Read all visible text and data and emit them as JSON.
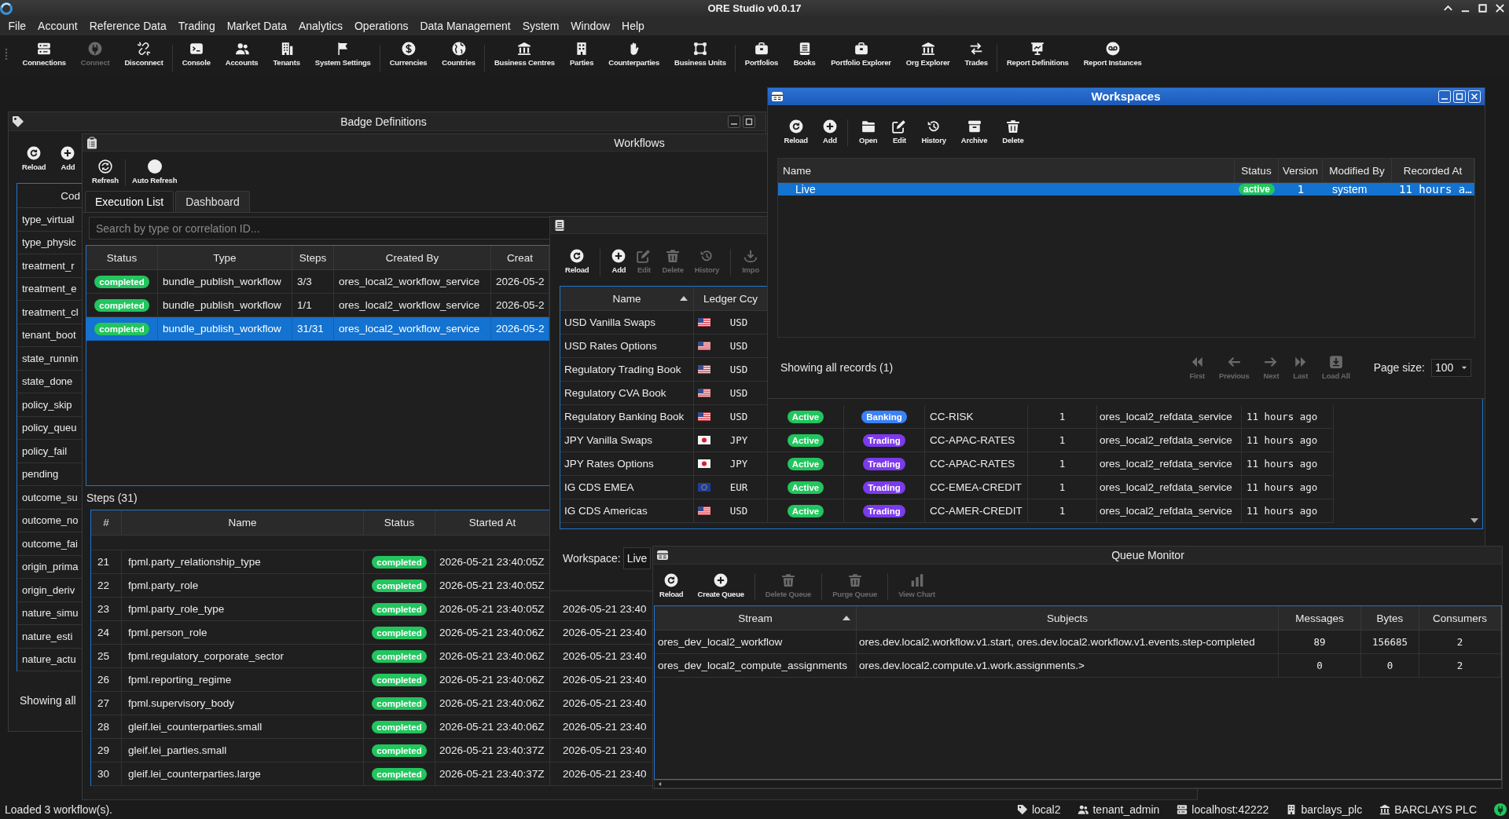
{
  "window": {
    "title": "ORE Studio v0.0.17"
  },
  "menu": [
    "File",
    "Account",
    "Reference Data",
    "Trading",
    "Market Data",
    "Analytics",
    "Operations",
    "Data Management",
    "System",
    "Window",
    "Help"
  ],
  "toolbar": [
    [
      {
        "label": "Connections",
        "disabled": false
      },
      {
        "label": "Connect",
        "disabled": true
      },
      {
        "label": "Disconnect",
        "disabled": false
      }
    ],
    [
      {
        "label": "Console",
        "disabled": false
      },
      {
        "label": "Accounts",
        "disabled": false
      },
      {
        "label": "Tenants",
        "disabled": false
      },
      {
        "label": "System Settings",
        "disabled": false
      }
    ],
    [
      {
        "label": "Currencies",
        "disabled": false
      },
      {
        "label": "Countries",
        "disabled": false
      }
    ],
    [
      {
        "label": "Business Centres",
        "disabled": false
      },
      {
        "label": "Parties",
        "disabled": false
      },
      {
        "label": "Counterparties",
        "disabled": false
      },
      {
        "label": "Business Units",
        "disabled": false
      }
    ],
    [
      {
        "label": "Portfolios",
        "disabled": false
      },
      {
        "label": "Books",
        "disabled": false
      },
      {
        "label": "Portfolio Explorer",
        "disabled": false
      },
      {
        "label": "Org Explorer",
        "disabled": false
      },
      {
        "label": "Trades",
        "disabled": false
      }
    ],
    [
      {
        "label": "Report Definitions",
        "disabled": false
      },
      {
        "label": "Report Instances",
        "disabled": false
      }
    ]
  ],
  "badge_definitions": {
    "title": "Badge Definitions",
    "active": false,
    "toolbar": [
      {
        "label": "Reload",
        "disabled": false
      },
      {
        "label": "Add",
        "disabled": false
      }
    ],
    "table": {
      "columns": [
        "Cod"
      ],
      "rows": [
        "type_virtual",
        "type_physic",
        "treatment_r",
        "treatment_e",
        "treatment_cl",
        "tenant_boot",
        "state_runnin",
        "state_done",
        "policy_skip",
        "policy_queu",
        "policy_fail",
        "pending",
        "outcome_su",
        "outcome_no",
        "outcome_fai",
        "origin_prima",
        "origin_deriv",
        "nature_simu",
        "nature_esti",
        "nature_actu"
      ]
    },
    "footer": "Showing all"
  },
  "workflows": {
    "title": "Workflows",
    "active": false,
    "toolbar": [
      {
        "label": "Refresh",
        "disabled": false
      },
      {
        "label": "Auto Refresh",
        "disabled": false
      }
    ],
    "tabs": [
      {
        "label": "Execution List",
        "selected": true
      },
      {
        "label": "Dashboard",
        "selected": false
      }
    ],
    "search": {
      "placeholder": "Search by type or correlation ID..."
    },
    "executions": {
      "columns": [
        "Status",
        "Type",
        "Steps",
        "Created By",
        "Creat"
      ],
      "rows": [
        {
          "status": "completed",
          "type": "bundle_publish_workflow",
          "steps": "3/3",
          "created_by": "ores_local2_workflow_service",
          "column_5": "2026-05-2",
          "selected": false
        },
        {
          "status": "completed",
          "type": "bundle_publish_workflow",
          "steps": "1/1",
          "created_by": "ores_local2_workflow_service",
          "column_5": "2026-05-2",
          "selected": false
        },
        {
          "status": "completed",
          "type": "bundle_publish_workflow",
          "steps": "31/31",
          "created_by": "ores_local2_workflow_service",
          "column_5": "2026-05-2",
          "selected": true
        }
      ]
    },
    "steps": {
      "title": "Steps (31)",
      "columns": [
        "#",
        "Name",
        "Status",
        "Started At"
      ],
      "rows": [
        {
          "number": "21",
          "name": "fpml.party_relationship_type",
          "status": "completed",
          "started_at": "2026-05-21 23:40:05Z"
        },
        {
          "number": "22",
          "name": "fpml.party_role",
          "status": "completed",
          "started_at": "2026-05-21 23:40:05Z"
        },
        {
          "number": "23",
          "name": "fpml.party_role_type",
          "status": "completed",
          "started_at": "2026-05-21 23:40:05Z",
          "column_5": "2026-05-21 23:40"
        },
        {
          "number": "24",
          "name": "fpml.person_role",
          "status": "completed",
          "started_at": "2026-05-21 23:40:06Z",
          "column_5": "2026-05-21 23:40"
        },
        {
          "number": "25",
          "name": "fpml.regulatory_corporate_sector",
          "status": "completed",
          "started_at": "2026-05-21 23:40:06Z",
          "column_5": "2026-05-21 23:40"
        },
        {
          "number": "26",
          "name": "fpml.reporting_regime",
          "status": "completed",
          "started_at": "2026-05-21 23:40:06Z",
          "column_5": "2026-05-21 23:40"
        },
        {
          "number": "27",
          "name": "fpml.supervisory_body",
          "status": "completed",
          "started_at": "2026-05-21 23:40:06Z",
          "column_5": "2026-05-21 23:40"
        },
        {
          "number": "28",
          "name": "gleif.lei_counterparties.small",
          "status": "completed",
          "started_at": "2026-05-21 23:40:06Z",
          "column_5": "2026-05-21 23:40"
        },
        {
          "number": "29",
          "name": "gleif.lei_parties.small",
          "status": "completed",
          "started_at": "2026-05-21 23:40:37Z",
          "column_5": "2026-05-21 23:40"
        },
        {
          "number": "30",
          "name": "gleif.lei_counterparties.large",
          "status": "completed",
          "started_at": "2026-05-21 23:40:37Z",
          "column_5": "2026-05-21 23:40"
        }
      ]
    }
  },
  "books": {
    "active": false,
    "toolbar": [
      {
        "label": "Reload",
        "disabled": false
      },
      {
        "label": "Add",
        "disabled": false
      },
      {
        "label": "Edit",
        "disabled": true
      },
      {
        "label": "Delete",
        "disabled": true
      },
      {
        "label": "History",
        "disabled": true
      },
      {
        "label": "Impo",
        "disabled": true
      }
    ],
    "table": {
      "columns": [
        {
          "label": "Name",
          "sorted": true
        },
        {
          "label": "Ledger Ccy",
          "sorted": false
        }
      ],
      "rows": [
        {
          "name": "USD Vanilla Swaps",
          "kind": "us",
          "ledger_ccy": "USD"
        },
        {
          "name": "USD Rates Options",
          "kind": "us",
          "ledger_ccy": "USD"
        },
        {
          "name": "Regulatory Trading Book",
          "kind": "us",
          "ledger_ccy": "USD"
        },
        {
          "name": "Regulatory CVA Book",
          "kind": "us",
          "ledger_ccy": "USD"
        },
        {
          "name": "Regulatory Banking Book",
          "kind": "us",
          "ledger_ccy": "USD",
          "column_3": "Active",
          "column_4": {
            "text": "Banking",
            "color": "#3b82f6"
          },
          "column_5": "CC-RISK",
          "column_6": "1",
          "column_7": "ores_local2_refdata_service",
          "column_8": "11 hours ago"
        },
        {
          "name": "JPY Vanilla Swaps",
          "kind": "jp",
          "ledger_ccy": "JPY",
          "column_3": "Active",
          "column_4": {
            "text": "Trading",
            "color": "#7c3aed"
          },
          "column_5": "CC-APAC-RATES",
          "column_6": "1",
          "column_7": "ores_local2_refdata_service",
          "column_8": "11 hours ago"
        },
        {
          "name": "JPY Rates Options",
          "kind": "jp",
          "ledger_ccy": "JPY",
          "column_3": "Active",
          "column_4": {
            "text": "Trading",
            "color": "#7c3aed"
          },
          "column_5": "CC-APAC-RATES",
          "column_6": "1",
          "column_7": "ores_local2_refdata_service",
          "column_8": "11 hours ago"
        },
        {
          "name": "IG CDS EMEA",
          "kind": "eu",
          "ledger_ccy": "EUR",
          "column_3": "Active",
          "column_4": {
            "text": "Trading",
            "color": "#7c3aed"
          },
          "column_5": "CC-EMEA-CREDIT",
          "column_6": "1",
          "column_7": "ores_local2_refdata_service",
          "column_8": "11 hours ago"
        },
        {
          "name": "IG CDS Americas",
          "kind": "us",
          "ledger_ccy": "USD",
          "column_3": "Active",
          "column_4": {
            "text": "Trading",
            "color": "#7c3aed"
          },
          "column_5": "CC-AMER-CREDIT",
          "column_6": "1",
          "column_7": "ores_local2_refdata_service",
          "column_8": "11 hours ago"
        }
      ]
    },
    "footer": {
      "label": "Workspace:",
      "value": "Live"
    }
  },
  "workspaces": {
    "title": "Workspaces",
    "active": true,
    "toolbar": [
      {
        "label": "Reload",
        "disabled": false
      },
      {
        "label": "Add",
        "disabled": false
      },
      {
        "label": "Open",
        "disabled": false
      },
      {
        "label": "Edit",
        "disabled": false
      },
      {
        "label": "History",
        "disabled": false
      },
      {
        "label": "Archive",
        "disabled": false
      },
      {
        "label": "Delete",
        "disabled": false
      }
    ],
    "table": {
      "columns": [
        "Name",
        "Status",
        "Version",
        "Modified By",
        "Recorded At"
      ],
      "rows": [
        {
          "name": "Live",
          "status": "active",
          "version": "1",
          "modified_by": "system",
          "recorded_at": "11 hours a…",
          "selected": true
        }
      ]
    },
    "record_count": "Showing all records (1)",
    "pager": [
      {
        "label": "First",
        "disabled": true
      },
      {
        "label": "Previous",
        "disabled": true
      },
      {
        "label": "Next",
        "disabled": true
      },
      {
        "label": "Last",
        "disabled": true
      },
      {
        "label": "Load All",
        "disabled": true
      }
    ],
    "page_size": {
      "label": "Page size:",
      "value": "100"
    }
  },
  "queue_monitor": {
    "title": "Queue Monitor",
    "active": false,
    "toolbar": [
      {
        "label": "Reload",
        "disabled": false
      },
      {
        "label": "Create Queue",
        "disabled": false
      },
      {
        "label": "Delete Queue",
        "disabled": true
      },
      {
        "label": "Purge Queue",
        "disabled": true
      },
      {
        "label": "View Chart",
        "disabled": true
      }
    ],
    "table": {
      "columns": [
        {
          "label": "Stream",
          "sorted": true
        },
        {
          "label": "Subjects",
          "sorted": false
        },
        {
          "label": "Messages",
          "sorted": false
        },
        {
          "label": "Bytes",
          "sorted": false
        },
        {
          "label": "Consumers",
          "sorted": false
        }
      ],
      "rows": [
        {
          "stream": "ores_dev_local2_workflow",
          "subjects": "ores.dev.local2.workflow.v1.start, ores.dev.local2.workflow.v1.events.step-completed",
          "messages": "89",
          "bytes": "156685",
          "consumers": "2"
        },
        {
          "stream": "ores_dev_local2_compute_assignments",
          "subjects": "ores.dev.local2.compute.v1.work.assignments.>",
          "messages": "0",
          "bytes": "0",
          "consumers": "2"
        }
      ]
    }
  },
  "status_bar": {
    "message": "Loaded 3 workflow(s).",
    "items": [
      "local2",
      "tenant_admin",
      "localhost:42222",
      "barclays_plc",
      "BARCLAYS PLC"
    ],
    "connected": true
  }
}
